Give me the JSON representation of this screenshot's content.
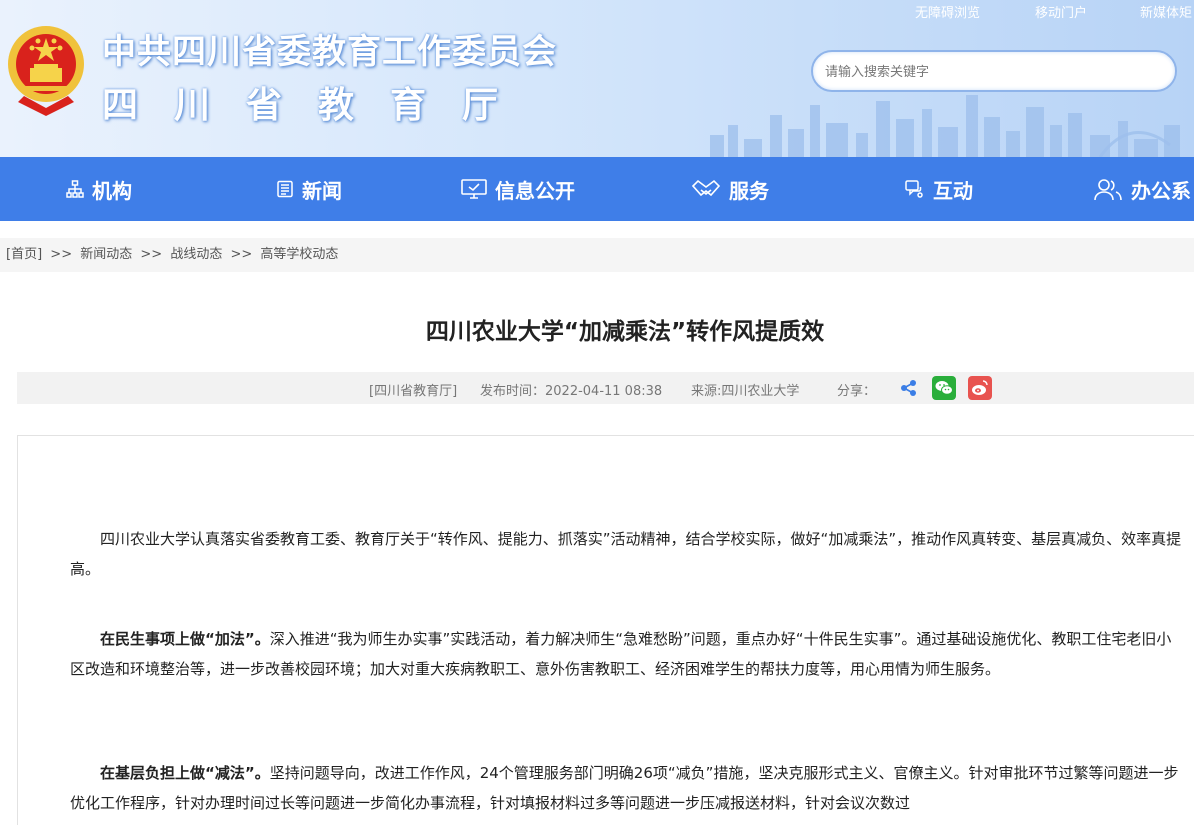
{
  "header": {
    "title_line1": "中共四川省委教育工作委员会",
    "title_line2": "四川省教育厅",
    "top_links": [
      "无障碍浏览",
      "移动门户",
      "新媒体矩"
    ],
    "search_placeholder": "请输入搜索关键字"
  },
  "nav": {
    "items": [
      {
        "label": "机构",
        "icon": "org-chart-icon"
      },
      {
        "label": "新闻",
        "icon": "news-icon"
      },
      {
        "label": "信息公开",
        "icon": "monitor-icon"
      },
      {
        "label": "服务",
        "icon": "handshake-icon"
      },
      {
        "label": "互动",
        "icon": "chat-icon"
      },
      {
        "label": "办公系",
        "icon": "users-icon"
      }
    ],
    "background_color": "#3f7ee8"
  },
  "breadcrumb": {
    "items": [
      "[首页]",
      "新闻动态",
      "战线动态",
      "高等学校动态"
    ],
    "separator": ">>"
  },
  "article": {
    "title": "四川农业大学“加减乘法”转作风提质效",
    "source_tag": "[四川省教育厅]",
    "publish_time": "发布时间：2022-04-11 08:38",
    "origin": "来源:四川农业大学",
    "share_label": "分享：",
    "share_icons": [
      "share-icon",
      "wechat-icon",
      "weibo-icon"
    ],
    "paragraphs": [
      {
        "lead": "",
        "text": "四川农业大学认真落实省委教育工委、教育厅关于“转作风、提能力、抓落实”活动精神，结合学校实际，做好“加减乘法”，推动作风真转变、基层真减负、效率真提高。"
      },
      {
        "lead": "在民生事项上做“加法”。",
        "text": "深入推进“我为师生办实事”实践活动，着力解决师生“急难愁盼”问题，重点办好“十件民生实事”。通过基础设施优化、教职工住宅老旧小区改造和环境整治等，进一步改善校园环境；加大对重大疾病教职工、意外伤害教职工、经济困难学生的帮扶力度等，用心用情为师生服务。"
      },
      {
        "lead": "在基层负担上做“减法”。",
        "text": "坚持问题导向，改进工作作风，24个管理服务部门明确26项“减负”措施，坚决克服形式主义、官僚主义。针对审批环节过繁等问题进一步优化工作程序，针对办理时间过长等问题进一步简化办事流程，针对填报材料过多等问题进一步压减报送材料，针对会议次数过"
      }
    ]
  }
}
